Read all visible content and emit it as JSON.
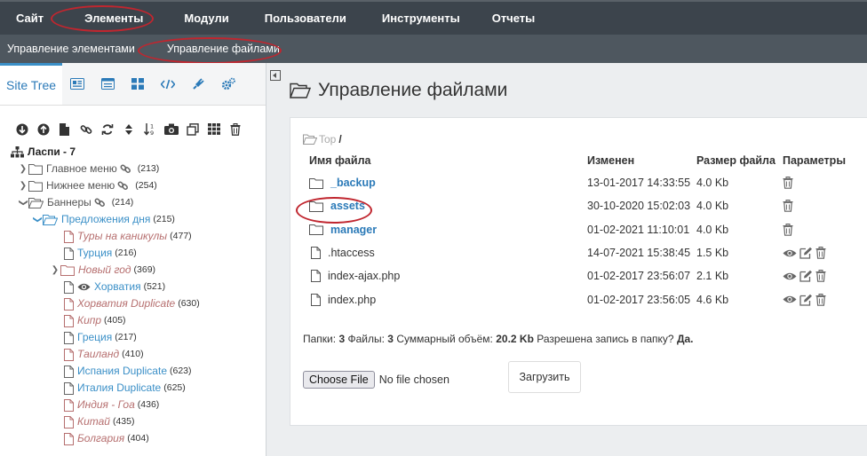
{
  "topnav": {
    "items": [
      {
        "label": "Сайт"
      },
      {
        "label": "Элементы"
      },
      {
        "label": "Модули"
      },
      {
        "label": "Пользователи"
      },
      {
        "label": "Инструменты"
      },
      {
        "label": "Отчеты"
      }
    ]
  },
  "subnav": {
    "items": [
      {
        "label": "Управление элементами"
      },
      {
        "label": "Управление файлами"
      }
    ]
  },
  "sidebar": {
    "active_tab": "Site Tree",
    "tab_icons": [
      "documents-icon",
      "list-icon",
      "grid-icon",
      "code-icon",
      "plug-icon",
      "cogs-icon"
    ],
    "toolbar_icons": [
      "arrow-circle-down-icon",
      "arrow-circle-up-icon",
      "file-icon",
      "link-icon",
      "refresh-icon",
      "sort-icon",
      "sort-numeric-icon",
      "camera-icon",
      "copy-icon",
      "grid-icon",
      "trash-icon"
    ],
    "tree": {
      "root": "Ласпи - 7",
      "nodes": [
        {
          "label": "Главное меню",
          "count": "(213)"
        },
        {
          "label": "Нижнее меню",
          "count": "(254)"
        },
        {
          "label": "Баннеры",
          "count": "(214)"
        },
        {
          "label": "Предложения дня",
          "count": "(215)"
        },
        {
          "label": "Туры на каникулы",
          "count": "(477)"
        },
        {
          "label": "Турция",
          "count": "(216)"
        },
        {
          "label": "Новый год",
          "count": "(369)"
        },
        {
          "label": "Хорватия",
          "count": "(521)"
        },
        {
          "label": "Хорватия Duplicate",
          "count": "(630)"
        },
        {
          "label": "Кипр",
          "count": "(405)"
        },
        {
          "label": "Греция",
          "count": "(217)"
        },
        {
          "label": "Таиланд",
          "count": "(410)"
        },
        {
          "label": "Испания Duplicate",
          "count": "(623)"
        },
        {
          "label": "Италия Duplicate",
          "count": "(625)"
        },
        {
          "label": "Индия - Гоа",
          "count": "(436)"
        },
        {
          "label": "Китай",
          "count": "(435)"
        },
        {
          "label": "Болгария",
          "count": "(404)"
        }
      ]
    }
  },
  "main": {
    "title": "Управление файлами",
    "breadcrumb": {
      "top": "Top",
      "sep": "/"
    },
    "table": {
      "headers": [
        "Имя файла",
        "Изменен",
        "Размер файла",
        "Параметры"
      ],
      "rows": [
        {
          "name": "_backup",
          "modified": "13-01-2017 14:33:55",
          "size": "4.0 Kb",
          "type": "dir"
        },
        {
          "name": "assets",
          "modified": "30-10-2020 15:02:03",
          "size": "4.0 Kb",
          "type": "dir"
        },
        {
          "name": "manager",
          "modified": "01-02-2021 11:10:01",
          "size": "4.0 Kb",
          "type": "dir"
        },
        {
          "name": ".htaccess",
          "modified": "14-07-2021 15:38:45",
          "size": "1.5 Kb",
          "type": "file"
        },
        {
          "name": "index-ajax.php",
          "modified": "01-02-2017 23:56:07",
          "size": "2.1 Kb",
          "type": "file"
        },
        {
          "name": "index.php",
          "modified": "01-02-2017 23:56:05",
          "size": "4.6 Kb",
          "type": "file"
        }
      ]
    },
    "summary": {
      "folders_label": "Папки:",
      "folders": "3",
      "files_label": "Файлы:",
      "files": "3",
      "total_label": "Суммарный объём:",
      "total": "20.2 Kb",
      "write_label": "Разрешена запись в папку?",
      "write": "Да."
    },
    "upload": {
      "choose_label": "Choose File",
      "no_file": "No file chosen",
      "upload_label": "Загрузить"
    }
  },
  "colors": {
    "accent": "#2b7ab8",
    "nav_bg": "#3c444c",
    "subnav_bg": "#4e575f",
    "highlight": "#c0262f"
  }
}
